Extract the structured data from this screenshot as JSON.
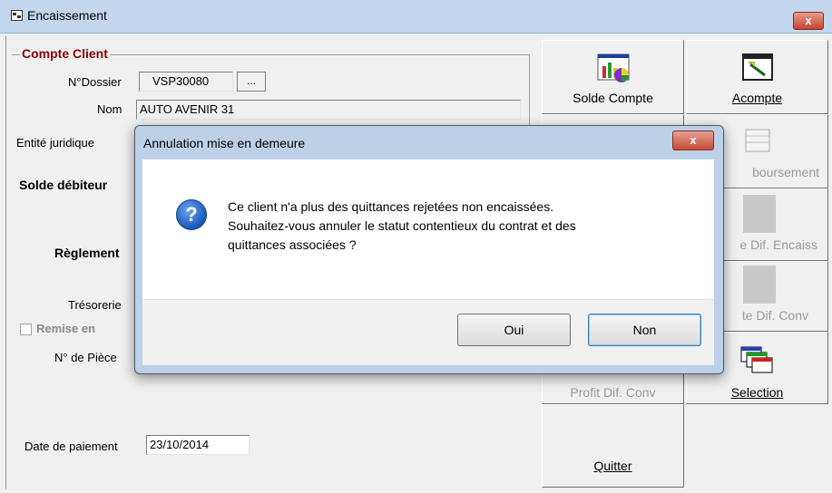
{
  "window": {
    "title": "Encaissement",
    "close": "x"
  },
  "form": {
    "group_title": "Compte Client",
    "dossier_label": "N°Dossier",
    "dossier_value": "VSP30080",
    "browse_label": "...",
    "nom_label": "Nom",
    "nom_value": "AUTO AVENIR 31",
    "entite_label": "Entité juridique",
    "solde_label": "Solde débiteur",
    "reglement_label": "Règlement",
    "tresorerie_label": "Trésorerie",
    "remise_label": "Remise en",
    "piece_label": "N° de Pièce",
    "date_label": "Date de paiement",
    "date_value": "23/10/2014"
  },
  "toolbar": {
    "solde_compte": "Solde Compte",
    "acompte": "Acompte",
    "remboursement": "boursement",
    "dif_encaiss": "e Dif. Encaiss",
    "dif_conv": "te Dif. Conv",
    "profit_dif_conv": "Profit Dif. Conv",
    "selection": "Selection",
    "quitter": "Quitter"
  },
  "dialog": {
    "title": "Annulation mise en demeure",
    "close": "x",
    "message_line1": "Ce client n'a plus des quittances rejetées non encaissées.",
    "message_line2": "Souhaitez-vous annuler le statut contentieux du contrat et des",
    "message_line3": "quittances associées ?",
    "icon": "question-icon",
    "yes": "Oui",
    "no": "Non"
  },
  "colors": {
    "titlebar": "#c2d6ee",
    "group_title": "#8b0000",
    "dialog_frame": "#bcd0e8"
  }
}
